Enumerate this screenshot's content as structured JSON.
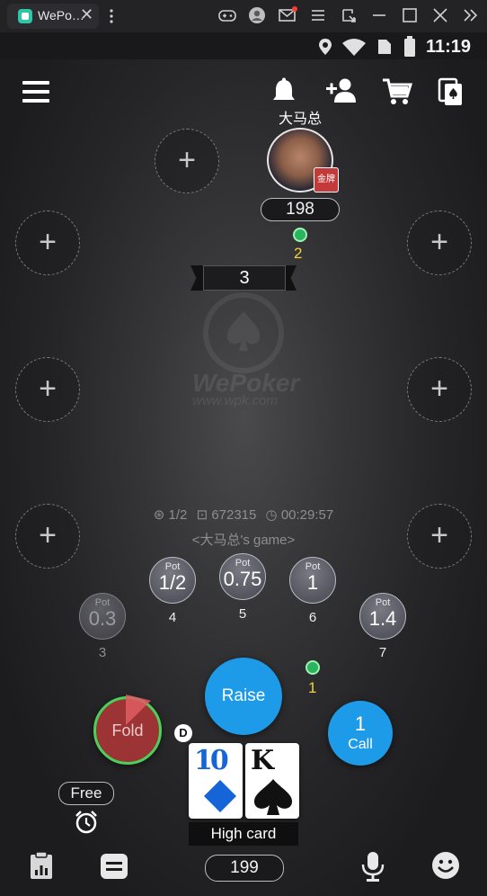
{
  "window": {
    "tab_title": "WePo…",
    "close_glyph": "✕",
    "toolbar_icons": [
      "gamepad-icon",
      "user-icon",
      "mail-icon",
      "menu-icon",
      "resize-icon",
      "minimize-icon",
      "maximize-icon",
      "close-icon",
      "collapse-icon"
    ]
  },
  "status_bar": {
    "time": "11:19"
  },
  "top_bar": {
    "player_name": "大马总"
  },
  "seats": {
    "plus": "+"
  },
  "player": {
    "stack": "198",
    "bet": "2",
    "card_label": "金牌"
  },
  "pot": {
    "value": "3"
  },
  "watermark": {
    "brand": "WePoker",
    "url": "www.wpk.com"
  },
  "game_info": {
    "blinds": "1/2",
    "room_id": "672315",
    "elapsed": "00:29:57",
    "game_name": "<大马总's game>"
  },
  "pot_buttons": [
    {
      "label": "Pot",
      "value": "0.3",
      "index": "3"
    },
    {
      "label": "Pot",
      "value": "1/2",
      "index": "4"
    },
    {
      "label": "Pot",
      "value": "0.75",
      "index": "5"
    },
    {
      "label": "Pot",
      "value": "1",
      "index": "6"
    },
    {
      "label": "Pot",
      "value": "1.4",
      "index": "7"
    }
  ],
  "my_bet": "1",
  "actions": {
    "fold": "Fold",
    "raise": "Raise",
    "call_amount": "1",
    "call": "Call"
  },
  "dealer": "D",
  "hand": {
    "cards": [
      {
        "rank": "10",
        "suit": "♦",
        "color": "#1565d8"
      },
      {
        "rank": "K",
        "suit": "♠",
        "color": "#111111"
      }
    ],
    "label": "High card"
  },
  "free_label": "Free",
  "my_stack": "199",
  "colors": {
    "accent": "#1e9be8",
    "fold": "#9c3436",
    "chip": "#2ab45b",
    "bet_text": "#f2d13c"
  }
}
